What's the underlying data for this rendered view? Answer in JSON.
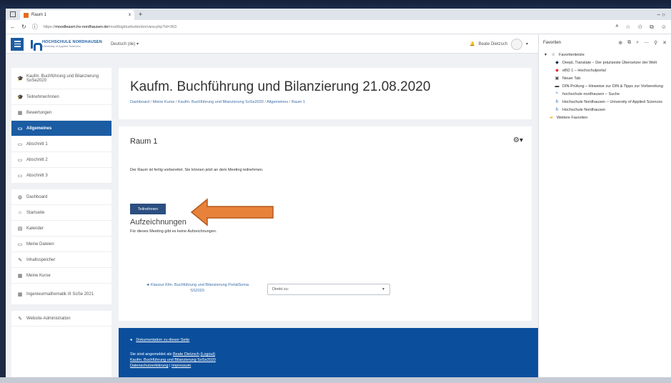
{
  "browser": {
    "tab_title": "Raum 1",
    "tab_close": "x",
    "new_tab": "+",
    "window_controls": "–   ○",
    "url_prefix": "https://",
    "url_host": "moodleasm.hs-nordhausen.de",
    "url_path": "/mod/bigbluebuttonbn/view.php?id=363"
  },
  "navbar": {
    "logo_line1": "HOCHSCHULE NORDHAUSEN",
    "logo_line2": "University of Applied Sciences",
    "language": "Deutsch (de) ▾",
    "user_name": "Beate Dietzsch"
  },
  "sidebar": {
    "items": [
      {
        "label": "Kaufm. Buchführung und Bilanzierung SoSe2020",
        "icon": "🎓"
      },
      {
        "label": "Teilnehmer/innen",
        "icon": "🎓"
      },
      {
        "label": "Bewertungen",
        "icon": "▦"
      },
      {
        "label": "Allgemeines",
        "icon": "▭"
      },
      {
        "label": "Abschnitt 1",
        "icon": "▭"
      },
      {
        "label": "Abschnitt 2",
        "icon": "▭"
      },
      {
        "label": "Abschnitt 3",
        "icon": "▭"
      },
      {
        "label": "Dashboard",
        "icon": "◍"
      },
      {
        "label": "Startseite",
        "icon": "⌂"
      },
      {
        "label": "Kalender",
        "icon": "▤"
      },
      {
        "label": "Meine Dateien",
        "icon": "▭"
      },
      {
        "label": "Inhaltsspeicher",
        "icon": "✎"
      },
      {
        "label": "Meine Kurse",
        "icon": "▦"
      },
      {
        "label": "Ingenieurmathematik III SoSe 2021",
        "icon": "▦"
      },
      {
        "label": "Website-Administration",
        "icon": "✎"
      }
    ]
  },
  "header": {
    "course_title": "Kaufm. Buchführung und Bilanzierung 21.08.2020",
    "breadcrumb": [
      "Dashboard",
      "Meine Kurse",
      "Kaufm. Buchführung und Bilanzierung SoSe2020",
      "Allgemeines",
      "Raum 1"
    ]
  },
  "content": {
    "room_title": "Raum 1",
    "room_text": "Der Raum ist fertig vorbereitet. Sie können jetzt an dem Meeting teilnehmen.",
    "join_label": "Teilnehmen",
    "recordings_title": "Aufzeichnungen",
    "recordings_text": "Für dieses Meeting gibt es keine Aufzeichnungen.",
    "prev_link": "◄ Klausur Kfm. Buchführung und Bilanzierung PortalSoma SS2020",
    "jump_label": "Direkt zu:",
    "arrow_color": "#e8823a"
  },
  "footer": {
    "doc_link": "Dokumentation zu dieser Seite",
    "logged_in_prefix": "Sie sind angemeldet als",
    "logged_in_user": "Beate Dietzsch",
    "logout": "(Logout)",
    "course_link": "Kaufm. Buchführung und Bilanzierung SoSe2020",
    "privacy": "Datenschutzerklärung",
    "imprint": "Impressum"
  },
  "favorites": {
    "title": "Favoriten",
    "bar_label": "Favoritenleiste",
    "items": [
      {
        "label": "DeepL Translate – Der präziseste Übersetzer der Welt",
        "icon": "◆",
        "color": "#0f2b46"
      },
      {
        "label": "eBD 1 – Hochschulportal",
        "icon": "◆",
        "color": "#d9232d"
      },
      {
        "label": "Neuer Tab",
        "icon": "▣",
        "color": "#555555"
      },
      {
        "label": "DIN-Prüfung – Hinweise zur DIN & Tipps zur Vorbereitung",
        "icon": "▬",
        "color": "#333333"
      },
      {
        "label": "hochschule nordhausen – Suche",
        "icon": "ʰ",
        "color": "#1b5ca3"
      },
      {
        "label": "Hochschule Nordhausen – University of Applied Sciences",
        "icon": "h",
        "color": "#1b5ca3"
      },
      {
        "label": "Hochschule Nordhausen",
        "icon": "h",
        "color": "#1b5ca3"
      }
    ],
    "other_folder": "Weitere Favoriten"
  }
}
